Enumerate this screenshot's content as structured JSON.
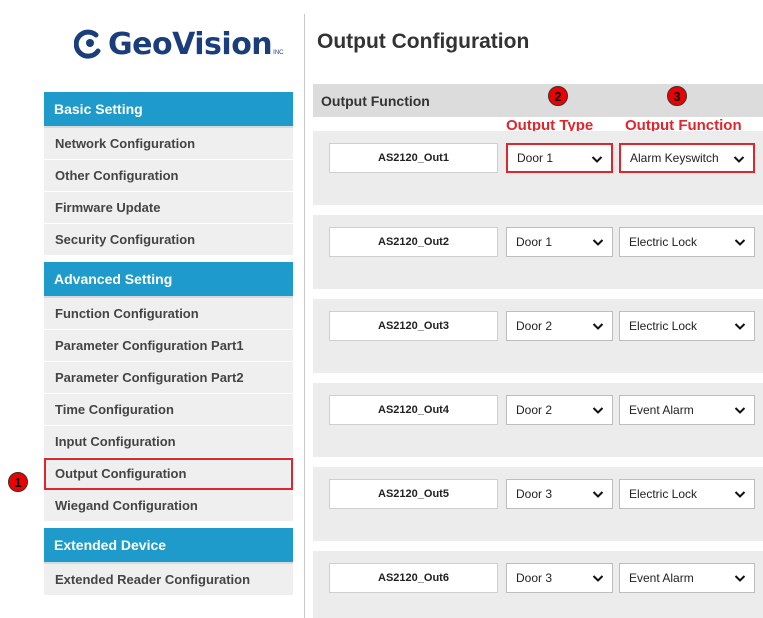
{
  "brand": {
    "name": "GeoVision",
    "tm": "INC"
  },
  "page": {
    "title": "Output Configuration"
  },
  "sidebar": {
    "sections": [
      {
        "title": "Basic Setting",
        "items": [
          "Network Configuration",
          "Other Configuration",
          "Firmware Update",
          "Security Configuration"
        ]
      },
      {
        "title": "Advanced Setting",
        "items": [
          "Function Configuration",
          "Parameter Configuration Part1",
          "Parameter Configuration Part2",
          "Time Configuration",
          "Input Configuration",
          "Output Configuration",
          "Wiegand Configuration"
        ]
      },
      {
        "title": "Extended Device",
        "items": [
          "Extended Reader Configuration"
        ]
      }
    ],
    "active_item": "Output Configuration"
  },
  "main": {
    "header": "Output Function",
    "annotations": {
      "badge_1": "1",
      "badge_2": "2",
      "badge_3": "3",
      "output_type_label": "Output Type",
      "output_function_label": "Output Function"
    },
    "rows": [
      {
        "name": "AS2120_Out1",
        "type": "Door 1",
        "function": "Alarm Keyswitch"
      },
      {
        "name": "AS2120_Out2",
        "type": "Door 1",
        "function": "Electric Lock"
      },
      {
        "name": "AS2120_Out3",
        "type": "Door 2",
        "function": "Electric Lock"
      },
      {
        "name": "AS2120_Out4",
        "type": "Door 2",
        "function": "Event Alarm"
      },
      {
        "name": "AS2120_Out5",
        "type": "Door 3",
        "function": "Electric Lock"
      },
      {
        "name": "AS2120_Out6",
        "type": "Door 3",
        "function": "Event Alarm"
      }
    ]
  },
  "colors": {
    "section_header": "#1f9bcb",
    "highlight": "#e0262c",
    "brand": "#1a3d7c"
  },
  "icons": {
    "select_arrow": "chevron-down-icon"
  }
}
